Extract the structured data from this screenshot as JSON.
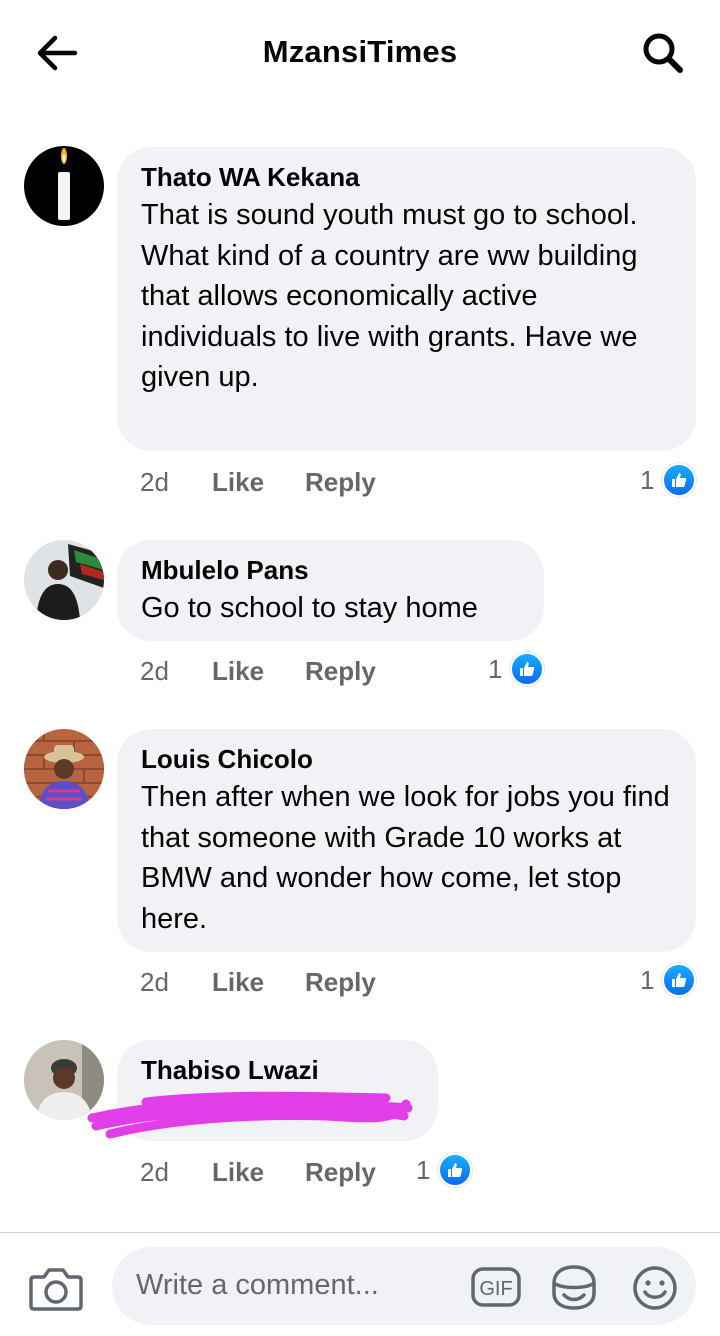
{
  "header": {
    "title": "MzansiTimes",
    "back_icon": "arrow-left-icon",
    "search_icon": "search-icon"
  },
  "comments": [
    {
      "author": "Thato WA Kekana",
      "text": "That is sound youth must go to school. What kind of a country are ww building that allows economically active individuals  to live with grants. Have we given up.",
      "time": "2d",
      "like_label": "Like",
      "reply_label": "Reply",
      "reactions": "1",
      "avatar": "candle-avatar"
    },
    {
      "author": "Mbulelo Pans",
      "text": "Go to school to stay home",
      "time": "2d",
      "like_label": "Like",
      "reply_label": "Reply",
      "reactions": "1",
      "avatar": "flag-avatar"
    },
    {
      "author": "Louis Chicolo",
      "text": "Then after when we look for jobs you find  that someone  with Grade 10 works at BMW and wonder how come, let stop here.",
      "time": "2d",
      "like_label": "Like",
      "reply_label": "Reply",
      "reactions": "1",
      "avatar": "hat-avatar"
    },
    {
      "author": "Thabiso Lwazi",
      "text": "",
      "time": "2d",
      "like_label": "Like",
      "reply_label": "Reply",
      "reactions": "1",
      "avatar": "person-avatar",
      "redaction_color": "#e23ee8"
    }
  ],
  "composer": {
    "placeholder": "Write a comment...",
    "gif_label": "GIF",
    "camera_icon": "camera-icon",
    "sticker_icon": "sticker-icon",
    "emoji_icon": "emoji-icon"
  },
  "colors": {
    "bubble": "#f0f2f5",
    "meta_text": "#65676b",
    "like_blue": "#1877f2"
  }
}
